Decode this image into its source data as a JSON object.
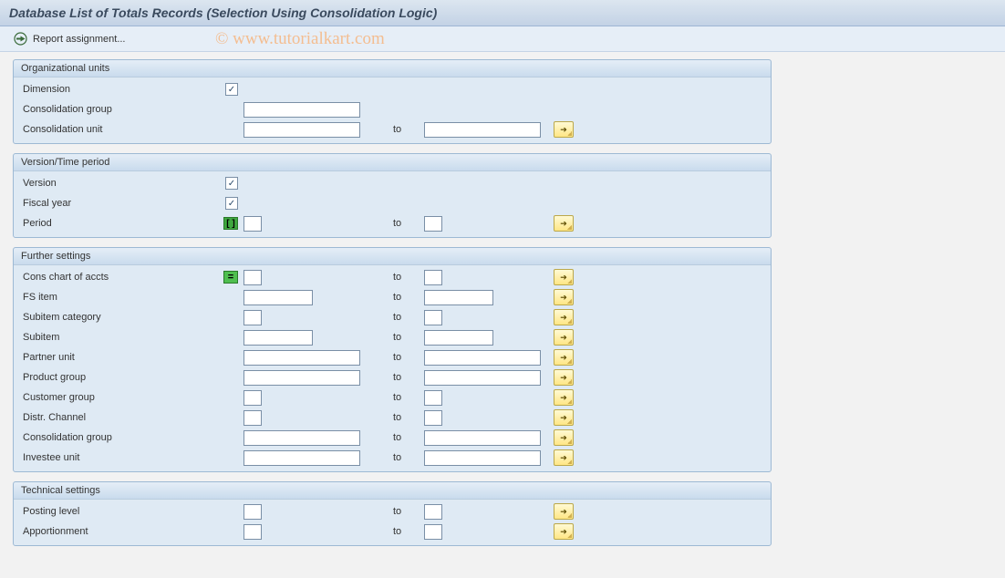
{
  "window": {
    "title": "Database List of Totals Records (Selection Using Consolidation Logic)"
  },
  "toolbar": {
    "execute_icon": "execute",
    "report_assignment": "Report assignment..."
  },
  "watermark": "© www.tutorialkart.com",
  "groups": {
    "org": {
      "title": "Organizational units",
      "dimension": "Dimension",
      "consolidation_group": "Consolidation group",
      "consolidation_unit": "Consolidation unit",
      "to": "to"
    },
    "version": {
      "title": "Version/Time period",
      "version": "Version",
      "fiscal_year": "Fiscal year",
      "period": "Period",
      "to": "to"
    },
    "further": {
      "title": "Further settings",
      "cons_chart": "Cons chart of accts",
      "fs_item": "FS item",
      "subitem_cat": "Subitem category",
      "subitem": "Subitem",
      "partner_unit": "Partner unit",
      "product_group": "Product group",
      "customer_group": "Customer group",
      "distr_channel": "Distr. Channel",
      "consolidation_group": "Consolidation group",
      "investee_unit": "Investee unit",
      "to": "to"
    },
    "technical": {
      "title": "Technical settings",
      "posting_level": "Posting level",
      "apportionment": "Apportionment",
      "to": "to"
    }
  },
  "indicators": {
    "check": "✓",
    "bracket": "[ ]",
    "equal": "="
  }
}
